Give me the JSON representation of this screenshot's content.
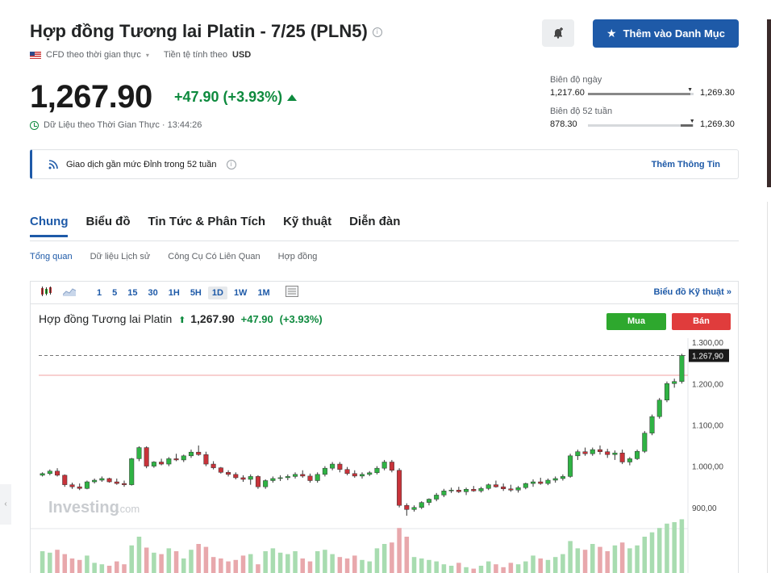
{
  "header": {
    "title": "Hợp đồng Tương lai Platin - 7/25 (PLN5)",
    "cfd_label": "CFD theo thời gian thực",
    "currency_label": "Tiền tệ tính theo",
    "currency": "USD",
    "watchlist_button": "Thêm vào Danh Mục"
  },
  "quote": {
    "price": "1,267.90",
    "change": "+47.90 (+3.93%)",
    "realtime_label": "Dữ Liệu theo Thời Gian Thực · 13:44:26"
  },
  "ranges": {
    "day_label": "Biên độ ngày",
    "day_low": "1,217.60",
    "day_high": "1,269.30",
    "day_position": 0.97,
    "week52_label": "Biên độ 52 tuần",
    "week52_low": "878.30",
    "week52_high": "1,269.30",
    "week52_position": 0.99
  },
  "notice": {
    "text": "Giao dịch gần mức Đỉnh trong 52 tuần",
    "more": "Thêm Thông Tin"
  },
  "tabs": [
    "Chung",
    "Biểu đồ",
    "Tin Tức & Phân Tích",
    "Kỹ thuật",
    "Diễn đàn"
  ],
  "subtabs": [
    "Tổng quan",
    "Dữ liệu Lịch sử",
    "Công Cụ Có Liên Quan",
    "Hợp đồng"
  ],
  "chart_toolbar": {
    "intervals": [
      "1",
      "5",
      "15",
      "30",
      "1H",
      "5H",
      "1D",
      "1W",
      "1M"
    ],
    "selected": "1D",
    "tech_link": "Biểu đồ Kỹ thuật »"
  },
  "chart_header": {
    "name": "Hợp đồng Tương lai Platin",
    "price": "1,267.90",
    "change": "+47.90",
    "pct": "(+3.93%)",
    "buy": "Mua",
    "sell": "Bán",
    "watermark": "Investing",
    "watermark_suffix": ".com"
  },
  "chart_data": {
    "type": "candlestick",
    "yticks": [
      "1.300,00",
      "1.200,00",
      "1.100,00",
      "1.000,00",
      "900,00"
    ],
    "ylim": [
      880,
      1310
    ],
    "last_label": "1.267,90",
    "last": 1267.9,
    "prev_close": 1220,
    "candles": [
      [
        978,
        985,
        975,
        982
      ],
      [
        982,
        992,
        978,
        988
      ],
      [
        988,
        995,
        975,
        978
      ],
      [
        978,
        980,
        950,
        955
      ],
      [
        955,
        960,
        945,
        950
      ],
      [
        950,
        958,
        942,
        946
      ],
      [
        946,
        965,
        944,
        962
      ],
      [
        962,
        970,
        958,
        966
      ],
      [
        966,
        975,
        962,
        970
      ],
      [
        970,
        972,
        960,
        962
      ],
      [
        962,
        970,
        955,
        958
      ],
      [
        958,
        965,
        950,
        955
      ],
      [
        955,
        1020,
        953,
        1018
      ],
      [
        1018,
        1048,
        1012,
        1045
      ],
      [
        1045,
        1048,
        995,
        1000
      ],
      [
        1000,
        1012,
        996,
        1010
      ],
      [
        1010,
        1018,
        1002,
        1005
      ],
      [
        1005,
        1022,
        1000,
        1018
      ],
      [
        1018,
        1030,
        1012,
        1015
      ],
      [
        1015,
        1028,
        1010,
        1025
      ],
      [
        1025,
        1040,
        1020,
        1034
      ],
      [
        1034,
        1050,
        1025,
        1028
      ],
      [
        1028,
        1035,
        1000,
        1005
      ],
      [
        1005,
        1012,
        992,
        996
      ],
      [
        996,
        998,
        982,
        985
      ],
      [
        985,
        990,
        975,
        980
      ],
      [
        980,
        985,
        968,
        972
      ],
      [
        972,
        978,
        962,
        968
      ],
      [
        968,
        980,
        955,
        975
      ],
      [
        975,
        978,
        945,
        950
      ],
      [
        950,
        968,
        945,
        965
      ],
      [
        965,
        975,
        960,
        970
      ],
      [
        970,
        978,
        964,
        972
      ],
      [
        972,
        980,
        966,
        975
      ],
      [
        975,
        985,
        970,
        980
      ],
      [
        980,
        990,
        972,
        976
      ],
      [
        976,
        982,
        960,
        965
      ],
      [
        965,
        985,
        960,
        980
      ],
      [
        980,
        1000,
        975,
        995
      ],
      [
        995,
        1010,
        990,
        1005
      ],
      [
        1005,
        1010,
        985,
        992
      ],
      [
        992,
        998,
        978,
        982
      ],
      [
        982,
        990,
        972,
        976
      ],
      [
        976,
        985,
        970,
        980
      ],
      [
        980,
        988,
        976,
        984
      ],
      [
        984,
        1000,
        980,
        995
      ],
      [
        995,
        1015,
        990,
        1010
      ],
      [
        1010,
        1015,
        985,
        990
      ],
      [
        990,
        995,
        900,
        905
      ],
      [
        905,
        910,
        880,
        895
      ],
      [
        895,
        905,
        890,
        900
      ],
      [
        900,
        915,
        896,
        912
      ],
      [
        912,
        922,
        905,
        920
      ],
      [
        920,
        935,
        915,
        930
      ],
      [
        930,
        945,
        925,
        940
      ],
      [
        940,
        948,
        935,
        942
      ],
      [
        942,
        950,
        935,
        938
      ],
      [
        938,
        948,
        930,
        944
      ],
      [
        944,
        952,
        938,
        940
      ],
      [
        940,
        950,
        936,
        946
      ],
      [
        946,
        958,
        942,
        955
      ],
      [
        955,
        965,
        948,
        950
      ],
      [
        950,
        958,
        940,
        945
      ],
      [
        945,
        955,
        938,
        942
      ],
      [
        942,
        952,
        936,
        948
      ],
      [
        948,
        960,
        944,
        958
      ],
      [
        958,
        968,
        950,
        962
      ],
      [
        962,
        972,
        955,
        958
      ],
      [
        958,
        970,
        954,
        966
      ],
      [
        966,
        975,
        960,
        970
      ],
      [
        970,
        980,
        965,
        975
      ],
      [
        975,
        1030,
        972,
        1025
      ],
      [
        1025,
        1040,
        1015,
        1035
      ],
      [
        1035,
        1045,
        1025,
        1030
      ],
      [
        1030,
        1045,
        1025,
        1040
      ],
      [
        1040,
        1050,
        1028,
        1035
      ],
      [
        1035,
        1042,
        1020,
        1028
      ],
      [
        1028,
        1038,
        1015,
        1032
      ],
      [
        1032,
        1040,
        1005,
        1010
      ],
      [
        1010,
        1022,
        1002,
        1018
      ],
      [
        1018,
        1040,
        1015,
        1036
      ],
      [
        1036,
        1085,
        1032,
        1080
      ],
      [
        1080,
        1125,
        1075,
        1120
      ],
      [
        1120,
        1165,
        1115,
        1160
      ],
      [
        1160,
        1205,
        1155,
        1200
      ],
      [
        1200,
        1212,
        1190,
        1205
      ],
      [
        1205,
        1272,
        1200,
        1267.9
      ]
    ],
    "volumes": [
      40,
      38,
      42,
      36,
      30,
      28,
      34,
      24,
      22,
      20,
      26,
      22,
      48,
      60,
      45,
      38,
      36,
      44,
      40,
      30,
      42,
      50,
      46,
      32,
      30,
      26,
      28,
      34,
      36,
      22,
      40,
      44,
      38,
      36,
      40,
      30,
      26,
      40,
      42,
      36,
      32,
      30,
      34,
      28,
      26,
      44,
      50,
      52,
      72,
      60,
      32,
      30,
      28,
      26,
      22,
      20,
      24,
      18,
      16,
      20,
      26,
      22,
      18,
      24,
      22,
      26,
      34,
      30,
      28,
      32,
      36,
      54,
      44,
      42,
      50,
      46,
      40,
      48,
      52,
      44,
      48,
      60,
      66,
      72,
      78,
      80,
      84
    ]
  }
}
